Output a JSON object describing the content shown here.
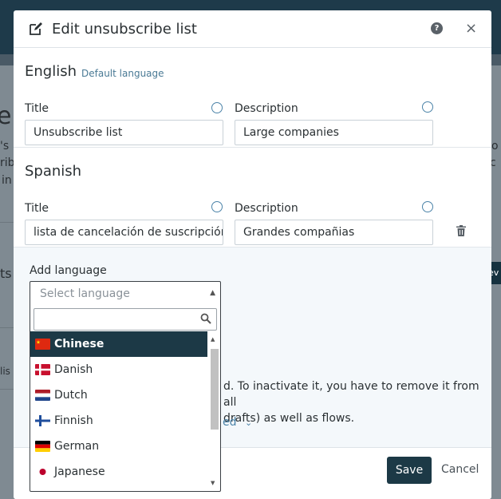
{
  "background": {
    "fragment_big": "e",
    "line1": "'s",
    "line2": "rib",
    "line3": "in",
    "line4": "ts",
    "line5": "lis",
    "right1": "o",
    "right2": "c",
    "btn": "ev"
  },
  "modal": {
    "title": "Edit unsubscribe list",
    "help_symbol": "?",
    "close_symbol": "×"
  },
  "english": {
    "heading": "English",
    "default_tag": "Default language",
    "title_label": "Title",
    "title_value": "Unsubscribe list",
    "desc_label": "Description",
    "desc_value": "Large companies"
  },
  "spanish": {
    "heading": "Spanish",
    "title_label": "Title",
    "title_value": "lista de cancelación de suscripción",
    "desc_label": "Description",
    "desc_value": "Grandes compañias"
  },
  "add_language": {
    "label": "Add language",
    "placeholder": "Select language",
    "search_value": "",
    "options": [
      {
        "label": "Chinese",
        "flag": "cn-flag-icon",
        "selected": true
      },
      {
        "label": "Danish",
        "flag": "dk-flag-icon",
        "selected": false
      },
      {
        "label": "Dutch",
        "flag": "nl-flag-icon",
        "selected": false
      },
      {
        "label": "Finnish",
        "flag": "fi-flag-icon",
        "selected": false
      },
      {
        "label": "German",
        "flag": "de-flag-icon",
        "selected": false
      },
      {
        "label": "Japanese",
        "flag": "jp-flag-icon",
        "selected": false
      }
    ]
  },
  "info": {
    "line1": "d. To inactivate it, you have to remove it from all",
    "line2": "drafts) as well as flows.",
    "link": "ed"
  },
  "footer": {
    "save": "Save",
    "cancel": "Cancel"
  },
  "colors": {
    "primary": "#1c3946",
    "accent": "#4b83a8",
    "overlay": "#7f8a92"
  }
}
